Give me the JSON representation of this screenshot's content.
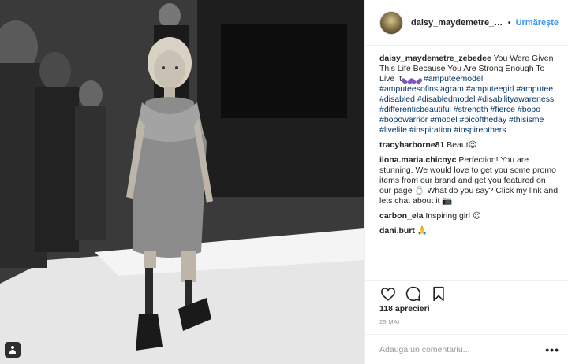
{
  "post": {
    "username": "daisy_maydemetre_zebedee",
    "username_display": "daisy_maydemetre_ze...",
    "dot": "•",
    "follow_label": "Urmărește",
    "caption_author": "daisy_maydemetre_zebedee",
    "caption_text": "You Were Given This Life Because You Are Strong Enough To Live It",
    "caption_hashtags": "#amputeemodel #amputeesofinstagram #amputeegirl #amputee #disabled #disabledmodel #disabilityawareness #differentisbeautiful #strength #fierce #bopo #bopowarrior #model #picoftheday #thisisme #livelife #inspiration #inspireothers"
  },
  "comments": [
    {
      "author": "tracyharborne81",
      "text": "Beaut",
      "emoji": "😍"
    },
    {
      "author": "ilona.maria.chicnyc",
      "text": "Perfection! You are stunning. We would love to get you some promo items from our brand and get you featured on our page",
      "emoji": "💍",
      "text2": "What do you say? Click my link and lets chat about it",
      "emoji2": "📷"
    },
    {
      "author": "carbon_ela",
      "text": "Inspiring girl",
      "emoji": "😍"
    },
    {
      "author": "dani.burt",
      "text": "",
      "emoji": "🙏"
    }
  ],
  "footer": {
    "likes": "118 aprecieri",
    "date": "29 MAI",
    "comment_placeholder": "Adaugă un comentariu...",
    "more": "•••"
  },
  "icons": {
    "like": "heart-icon",
    "comment": "comment-icon",
    "save": "bookmark-icon",
    "tag": "person-icon"
  }
}
